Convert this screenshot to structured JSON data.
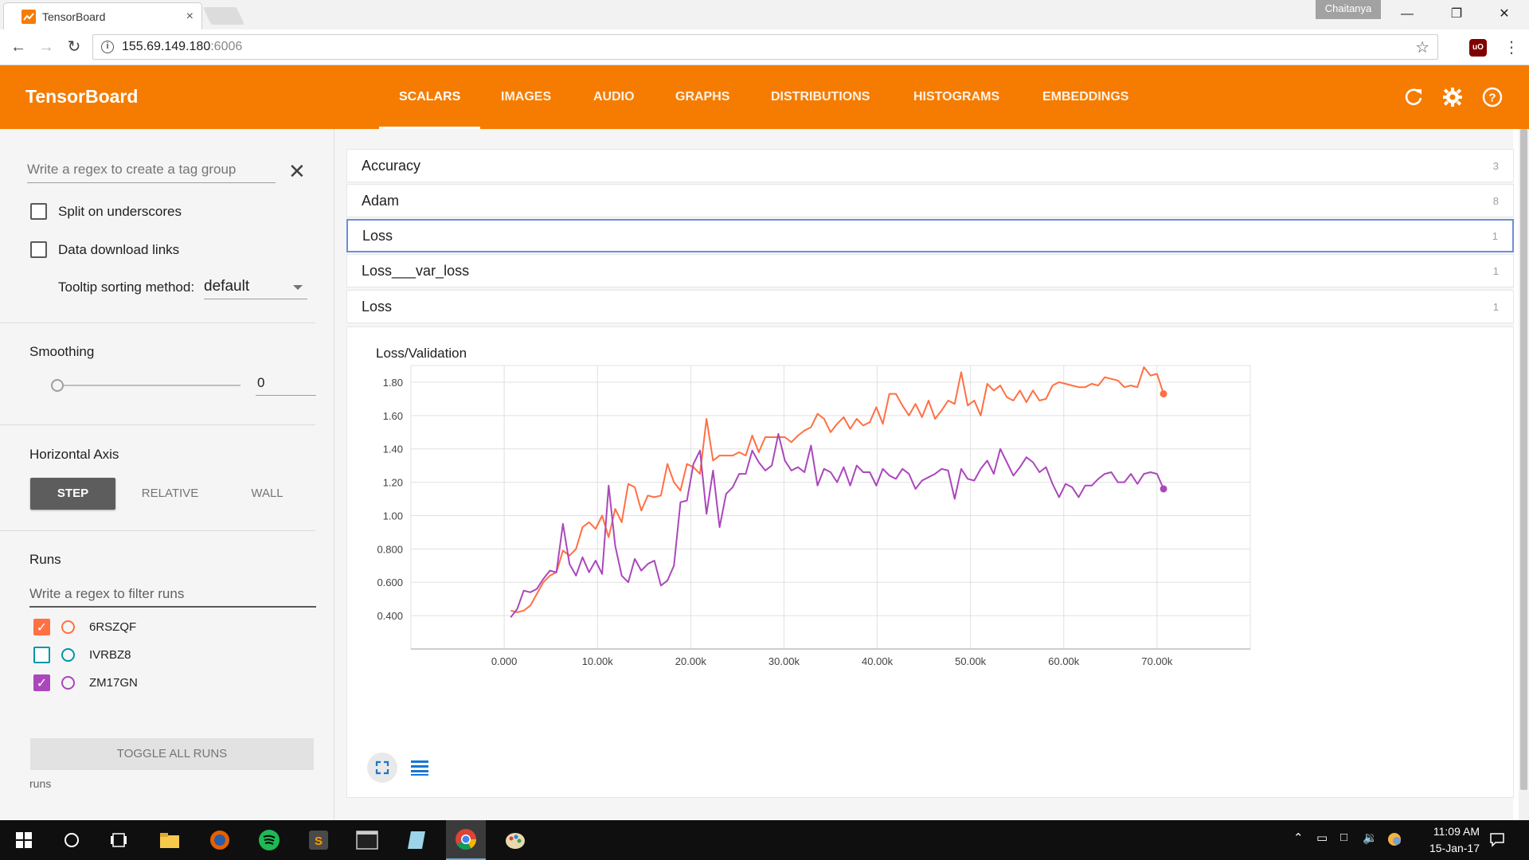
{
  "browser": {
    "tab_title": "TensorBoard",
    "tab_close": "×",
    "profile_name": "Chaitanya",
    "url_host": "155.69.149.180",
    "url_port": ":6006",
    "ublock_label": "uO"
  },
  "header": {
    "title": "TensorBoard",
    "tabs": [
      "SCALARS",
      "IMAGES",
      "AUDIO",
      "GRAPHS",
      "DISTRIBUTIONS",
      "HISTOGRAMS",
      "EMBEDDINGS"
    ],
    "active_tab": "SCALARS",
    "color": "#f57c00"
  },
  "sidebar": {
    "tag_regex_placeholder": "Write a regex to create a tag group",
    "split_underscores": {
      "label": "Split on underscores",
      "checked": false
    },
    "download_links": {
      "label": "Data download links",
      "checked": false
    },
    "tooltip_sort_label": "Tooltip sorting method:",
    "tooltip_sort_value": "default",
    "smoothing_title": "Smoothing",
    "smoothing_value": "0",
    "smoothing_level": 0,
    "horizontal_axis_title": "Horizontal Axis",
    "axis_options": [
      "STEP",
      "RELATIVE",
      "WALL"
    ],
    "axis_selected": "STEP",
    "runs_title": "Runs",
    "runs_filter_placeholder": "Write a regex to filter runs",
    "runs": [
      {
        "name": "6RSZQF",
        "checked": true,
        "color": "#ff7043"
      },
      {
        "name": "IVRBZ8",
        "checked": false,
        "color": "#0097a7"
      },
      {
        "name": "ZM17GN",
        "checked": true,
        "color": "#ab47bc"
      }
    ],
    "toggle_all_label": "TOGGLE ALL RUNS",
    "runs_footer": "runs"
  },
  "categories": [
    {
      "name": "Accuracy",
      "count": "3"
    },
    {
      "name": "Adam",
      "count": "8"
    },
    {
      "name": "Loss",
      "count": "1",
      "selected": true
    },
    {
      "name": "Loss___var_loss",
      "count": "1"
    },
    {
      "name": "Loss",
      "count": "1"
    }
  ],
  "chart_data": {
    "type": "line",
    "title": "Loss/Validation",
    "xlabel": "",
    "ylabel": "",
    "xlim": [
      -10000,
      80000
    ],
    "ylim": [
      0.2,
      1.9
    ],
    "x_ticks": [
      0,
      10000,
      20000,
      30000,
      40000,
      50000,
      60000,
      70000
    ],
    "x_tick_labels": [
      "0.000",
      "10.00k",
      "20.00k",
      "30.00k",
      "40.00k",
      "50.00k",
      "60.00k",
      "70.00k"
    ],
    "y_ticks": [
      0.4,
      0.6,
      0.8,
      1.0,
      1.2,
      1.4,
      1.6,
      1.8
    ],
    "y_tick_labels": [
      "0.400",
      "0.600",
      "0.800",
      "1.00",
      "1.20",
      "1.40",
      "1.60",
      "1.80"
    ],
    "grid": true,
    "series": [
      {
        "name": "6RSZQF",
        "color": "#ff7043",
        "x": [
          700,
          1400,
          2100,
          2800,
          3500,
          4200,
          4900,
          5600,
          6300,
          7000,
          7700,
          8400,
          9100,
          9800,
          10500,
          11200,
          11900,
          12600,
          13300,
          14000,
          14700,
          15400,
          16100,
          16800,
          17500,
          18200,
          18900,
          19600,
          20300,
          21000,
          21700,
          22400,
          23100,
          23800,
          24500,
          25200,
          25900,
          26600,
          27300,
          28000,
          28700,
          29400,
          30100,
          30800,
          31500,
          32200,
          32900,
          33600,
          34300,
          35000,
          35700,
          36400,
          37100,
          37800,
          38500,
          39200,
          39900,
          40600,
          41300,
          42000,
          42700,
          43400,
          44100,
          44800,
          45500,
          46200,
          46900,
          47600,
          48300,
          49000,
          49700,
          50400,
          51100,
          51800,
          52500,
          53200,
          53900,
          54600,
          55300,
          56000,
          56700,
          57400,
          58100,
          58800,
          59500,
          60200,
          60900,
          61600,
          62300,
          63000,
          63700,
          64400,
          65100,
          65800,
          66500,
          67200,
          67900,
          68600,
          69300,
          70000,
          70700
        ],
        "y": [
          0.43,
          0.42,
          0.43,
          0.46,
          0.53,
          0.6,
          0.64,
          0.66,
          0.79,
          0.76,
          0.8,
          0.93,
          0.96,
          0.92,
          1.0,
          0.87,
          1.04,
          0.96,
          1.19,
          1.17,
          1.03,
          1.12,
          1.11,
          1.12,
          1.31,
          1.2,
          1.15,
          1.31,
          1.29,
          1.25,
          1.58,
          1.33,
          1.36,
          1.36,
          1.36,
          1.38,
          1.36,
          1.48,
          1.38,
          1.47,
          1.47,
          1.47,
          1.47,
          1.44,
          1.48,
          1.51,
          1.53,
          1.61,
          1.58,
          1.5,
          1.55,
          1.59,
          1.52,
          1.58,
          1.54,
          1.56,
          1.65,
          1.55,
          1.73,
          1.73,
          1.66,
          1.6,
          1.67,
          1.59,
          1.69,
          1.58,
          1.63,
          1.69,
          1.67,
          1.86,
          1.66,
          1.69,
          1.6,
          1.79,
          1.75,
          1.78,
          1.71,
          1.69,
          1.75,
          1.68,
          1.75,
          1.69,
          1.7,
          1.78,
          1.8,
          1.79,
          1.78,
          1.77,
          1.77,
          1.79,
          1.78,
          1.83,
          1.82,
          1.81,
          1.77,
          1.78,
          1.77,
          1.89,
          1.84,
          1.85,
          1.73
        ]
      },
      {
        "name": "ZM17GN",
        "color": "#ab47bc",
        "x": [
          700,
          1400,
          2100,
          2800,
          3500,
          4200,
          4900,
          5600,
          6300,
          7000,
          7700,
          8400,
          9100,
          9800,
          10500,
          11200,
          11900,
          12600,
          13300,
          14000,
          14700,
          15400,
          16100,
          16800,
          17500,
          18200,
          18900,
          19600,
          20300,
          21000,
          21700,
          22400,
          23100,
          23800,
          24500,
          25200,
          25900,
          26600,
          27300,
          28000,
          28700,
          29400,
          30100,
          30800,
          31500,
          32200,
          32900,
          33600,
          34300,
          35000,
          35700,
          36400,
          37100,
          37800,
          38500,
          39200,
          39900,
          40600,
          41300,
          42000,
          42700,
          43400,
          44100,
          44800,
          45500,
          46200,
          46900,
          47600,
          48300,
          49000,
          49700,
          50400,
          51100,
          51800,
          52500,
          53200,
          53900,
          54600,
          55300,
          56000,
          56700,
          57400,
          58100,
          58800,
          59500,
          60200,
          60900,
          61600,
          62300,
          63000,
          63700,
          64400,
          65100,
          65800,
          66500,
          67200,
          67900,
          68600,
          69300,
          70000,
          70700
        ],
        "y": [
          0.39,
          0.44,
          0.55,
          0.54,
          0.56,
          0.62,
          0.67,
          0.66,
          0.95,
          0.71,
          0.64,
          0.75,
          0.66,
          0.73,
          0.65,
          1.18,
          0.82,
          0.64,
          0.6,
          0.74,
          0.67,
          0.71,
          0.73,
          0.58,
          0.61,
          0.7,
          1.08,
          1.09,
          1.31,
          1.39,
          1.01,
          1.27,
          0.93,
          1.13,
          1.17,
          1.25,
          1.25,
          1.39,
          1.32,
          1.27,
          1.3,
          1.49,
          1.33,
          1.27,
          1.29,
          1.26,
          1.42,
          1.18,
          1.28,
          1.26,
          1.2,
          1.29,
          1.18,
          1.3,
          1.26,
          1.26,
          1.18,
          1.28,
          1.24,
          1.22,
          1.28,
          1.25,
          1.16,
          1.21,
          1.23,
          1.25,
          1.28,
          1.27,
          1.1,
          1.28,
          1.22,
          1.21,
          1.28,
          1.33,
          1.25,
          1.4,
          1.32,
          1.24,
          1.29,
          1.35,
          1.32,
          1.26,
          1.29,
          1.19,
          1.11,
          1.19,
          1.17,
          1.11,
          1.18,
          1.18,
          1.22,
          1.25,
          1.26,
          1.2,
          1.2,
          1.25,
          1.19,
          1.25,
          1.26,
          1.25,
          1.16
        ]
      }
    ]
  },
  "taskbar": {
    "time": "11:09 AM",
    "date": "15-Jan-17"
  }
}
